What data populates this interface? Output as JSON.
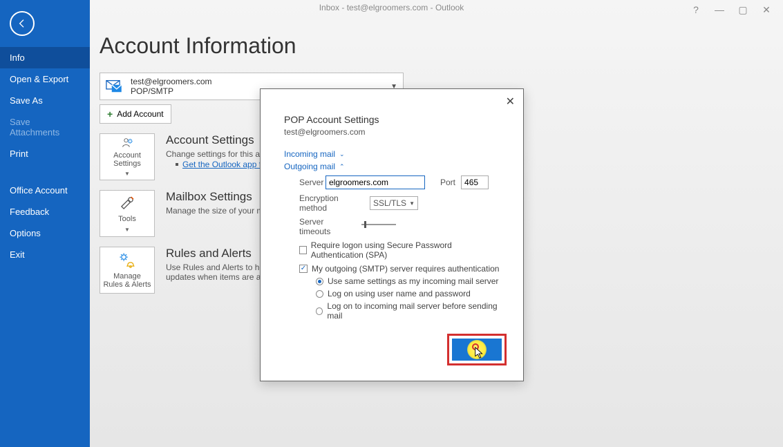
{
  "window": {
    "title": "Inbox - test@elgroomers.com - Outlook",
    "help": "?",
    "minimize": "—",
    "restore": "▢",
    "close": "✕"
  },
  "sidebar": {
    "items": [
      {
        "label": "Info",
        "state": "active"
      },
      {
        "label": "Open & Export",
        "state": ""
      },
      {
        "label": "Save As",
        "state": ""
      },
      {
        "label": "Save Attachments",
        "state": "disabled"
      },
      {
        "label": "Print",
        "state": ""
      }
    ],
    "group2": [
      {
        "label": "Office Account"
      },
      {
        "label": "Feedback"
      },
      {
        "label": "Options"
      },
      {
        "label": "Exit"
      }
    ]
  },
  "main": {
    "page_title": "Account Information",
    "account": {
      "email": "test@elgroomers.com",
      "type": "POP/SMTP"
    },
    "add_account": "Add Account",
    "sections": {
      "account_settings": {
        "tile": "Account Settings",
        "title": "Account Settings",
        "desc": "Change settings for this account or",
        "link": "Get the Outlook app for iPhone"
      },
      "mailbox": {
        "tile": "Tools",
        "title": "Mailbox Settings",
        "desc": "Manage the size of your mailbox by"
      },
      "rules": {
        "tile": "Manage Rules & Alerts",
        "title": "Rules and Alerts",
        "desc1": "Use Rules and Alerts to help organiz",
        "desc2": "updates when items are added, cha"
      }
    }
  },
  "popup": {
    "title": "POP Account Settings",
    "subtitle": "test@elgroomers.com",
    "sections": {
      "incoming": "Incoming mail",
      "outgoing": "Outgoing mail"
    },
    "fields": {
      "server_label": "Server",
      "server_value": "elgroomers.com",
      "port_label": "Port",
      "port_value": "465",
      "encryption_label": "Encryption method",
      "encryption_value": "SSL/TLS",
      "timeouts_label": "Server timeouts"
    },
    "checks": {
      "spa": "Require logon using Secure Password Authentication (SPA)",
      "smtp_auth": "My outgoing (SMTP) server requires authentication"
    },
    "radios": {
      "same": "Use same settings as my incoming mail server",
      "logon": "Log on using user name and password",
      "incoming_first": "Log on to incoming mail server before sending mail"
    }
  }
}
